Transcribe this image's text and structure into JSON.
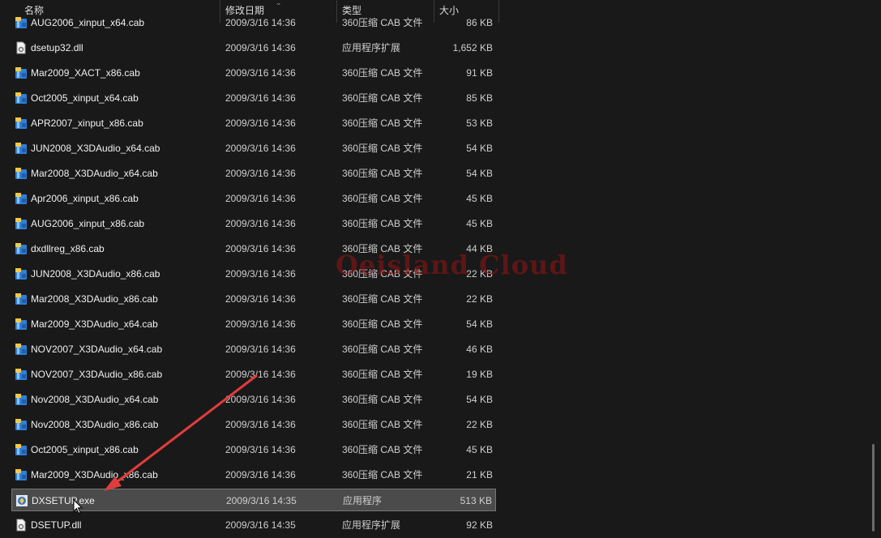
{
  "header": {
    "name_label": "名称",
    "date_label": "修改日期",
    "type_label": "类型",
    "size_label": "大小"
  },
  "files": [
    {
      "name": "AUG2006_xinput_x64.cab",
      "date": "2009/3/16 14:36",
      "type": "360压缩 CAB 文件",
      "size": "86 KB",
      "icon": "cab-archive-icon"
    },
    {
      "name": "dsetup32.dll",
      "date": "2009/3/16 14:36",
      "type": "应用程序扩展",
      "size": "1,652 KB",
      "icon": "dll-file-icon"
    },
    {
      "name": "Mar2009_XACT_x86.cab",
      "date": "2009/3/16 14:36",
      "type": "360压缩 CAB 文件",
      "size": "91 KB",
      "icon": "cab-archive-icon"
    },
    {
      "name": "Oct2005_xinput_x64.cab",
      "date": "2009/3/16 14:36",
      "type": "360压缩 CAB 文件",
      "size": "85 KB",
      "icon": "cab-archive-icon"
    },
    {
      "name": "APR2007_xinput_x86.cab",
      "date": "2009/3/16 14:36",
      "type": "360压缩 CAB 文件",
      "size": "53 KB",
      "icon": "cab-archive-icon"
    },
    {
      "name": "JUN2008_X3DAudio_x64.cab",
      "date": "2009/3/16 14:36",
      "type": "360压缩 CAB 文件",
      "size": "54 KB",
      "icon": "cab-archive-icon"
    },
    {
      "name": "Mar2008_X3DAudio_x64.cab",
      "date": "2009/3/16 14:36",
      "type": "360压缩 CAB 文件",
      "size": "54 KB",
      "icon": "cab-archive-icon"
    },
    {
      "name": "Apr2006_xinput_x86.cab",
      "date": "2009/3/16 14:36",
      "type": "360压缩 CAB 文件",
      "size": "45 KB",
      "icon": "cab-archive-icon"
    },
    {
      "name": "AUG2006_xinput_x86.cab",
      "date": "2009/3/16 14:36",
      "type": "360压缩 CAB 文件",
      "size": "45 KB",
      "icon": "cab-archive-icon"
    },
    {
      "name": "dxdllreg_x86.cab",
      "date": "2009/3/16 14:36",
      "type": "360压缩 CAB 文件",
      "size": "44 KB",
      "icon": "cab-archive-icon"
    },
    {
      "name": "JUN2008_X3DAudio_x86.cab",
      "date": "2009/3/16 14:36",
      "type": "360压缩 CAB 文件",
      "size": "22 KB",
      "icon": "cab-archive-icon"
    },
    {
      "name": "Mar2008_X3DAudio_x86.cab",
      "date": "2009/3/16 14:36",
      "type": "360压缩 CAB 文件",
      "size": "22 KB",
      "icon": "cab-archive-icon"
    },
    {
      "name": "Mar2009_X3DAudio_x64.cab",
      "date": "2009/3/16 14:36",
      "type": "360压缩 CAB 文件",
      "size": "54 KB",
      "icon": "cab-archive-icon"
    },
    {
      "name": "NOV2007_X3DAudio_x64.cab",
      "date": "2009/3/16 14:36",
      "type": "360压缩 CAB 文件",
      "size": "46 KB",
      "icon": "cab-archive-icon"
    },
    {
      "name": "NOV2007_X3DAudio_x86.cab",
      "date": "2009/3/16 14:36",
      "type": "360压缩 CAB 文件",
      "size": "19 KB",
      "icon": "cab-archive-icon"
    },
    {
      "name": "Nov2008_X3DAudio_x64.cab",
      "date": "2009/3/16 14:36",
      "type": "360压缩 CAB 文件",
      "size": "54 KB",
      "icon": "cab-archive-icon"
    },
    {
      "name": "Nov2008_X3DAudio_x86.cab",
      "date": "2009/3/16 14:36",
      "type": "360压缩 CAB 文件",
      "size": "22 KB",
      "icon": "cab-archive-icon"
    },
    {
      "name": "Oct2005_xinput_x86.cab",
      "date": "2009/3/16 14:36",
      "type": "360压缩 CAB 文件",
      "size": "45 KB",
      "icon": "cab-archive-icon"
    },
    {
      "name": "Mar2009_X3DAudio_x86.cab",
      "date": "2009/3/16 14:36",
      "type": "360压缩 CAB 文件",
      "size": "21 KB",
      "icon": "cab-archive-icon"
    },
    {
      "name": "DXSETUP.exe",
      "date": "2009/3/16 14:35",
      "type": "应用程序",
      "size": "513 KB",
      "icon": "setup-exe-icon",
      "selected": true
    },
    {
      "name": "DSETUP.dll",
      "date": "2009/3/16 14:35",
      "type": "应用程序扩展",
      "size": "92 KB",
      "icon": "dll-file-icon"
    }
  ],
  "watermark": "Oeisland Cloud",
  "colors": {
    "background": "#191919",
    "selected_row": "#4b4b4b",
    "annotation_arrow": "#e03c3c",
    "cab_icon_blue": "#2f7fd6",
    "cab_icon_yellow": "#f2c84b"
  }
}
